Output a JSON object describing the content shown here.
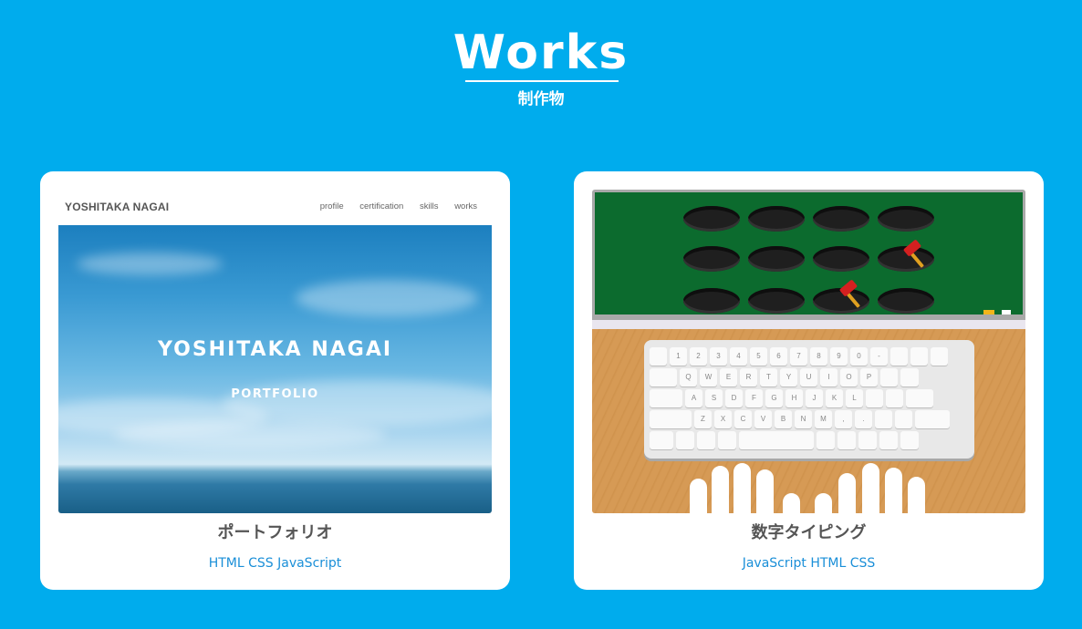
{
  "header": {
    "title": "Works",
    "subtitle": "制作物"
  },
  "works": [
    {
      "title": "ポートフォリオ",
      "tags": "HTML CSS JavaScript",
      "preview": {
        "brand": "YOSHITAKA NAGAI",
        "nav": [
          "profile",
          "certification",
          "skills",
          "works"
        ],
        "hero_title": "YOSHITAKA NAGAI",
        "hero_subtitle": "PORTFOLIO"
      }
    },
    {
      "title": "数字タイピング",
      "tags": "JavaScript HTML CSS",
      "preview": {
        "rows": [
          [
            "",
            "1",
            "2",
            "3",
            "4",
            "5",
            "6",
            "7",
            "8",
            "9",
            "0",
            "-",
            "",
            "",
            ""
          ],
          [
            "",
            "Q",
            "W",
            "E",
            "R",
            "T",
            "Y",
            "U",
            "I",
            "O",
            "P",
            "",
            ""
          ],
          [
            "",
            "A",
            "S",
            "D",
            "F",
            "G",
            "H",
            "J",
            "K",
            "L",
            "",
            "",
            ""
          ],
          [
            "",
            "Z",
            "X",
            "C",
            "V",
            "B",
            "N",
            "M",
            ",",
            ".",
            "",
            "",
            ""
          ]
        ]
      }
    }
  ],
  "colors": {
    "background": "#00aced",
    "card": "#ffffff",
    "tag": "#1a8fd8",
    "board": "#0c6b2e",
    "desk": "#d69a55"
  }
}
